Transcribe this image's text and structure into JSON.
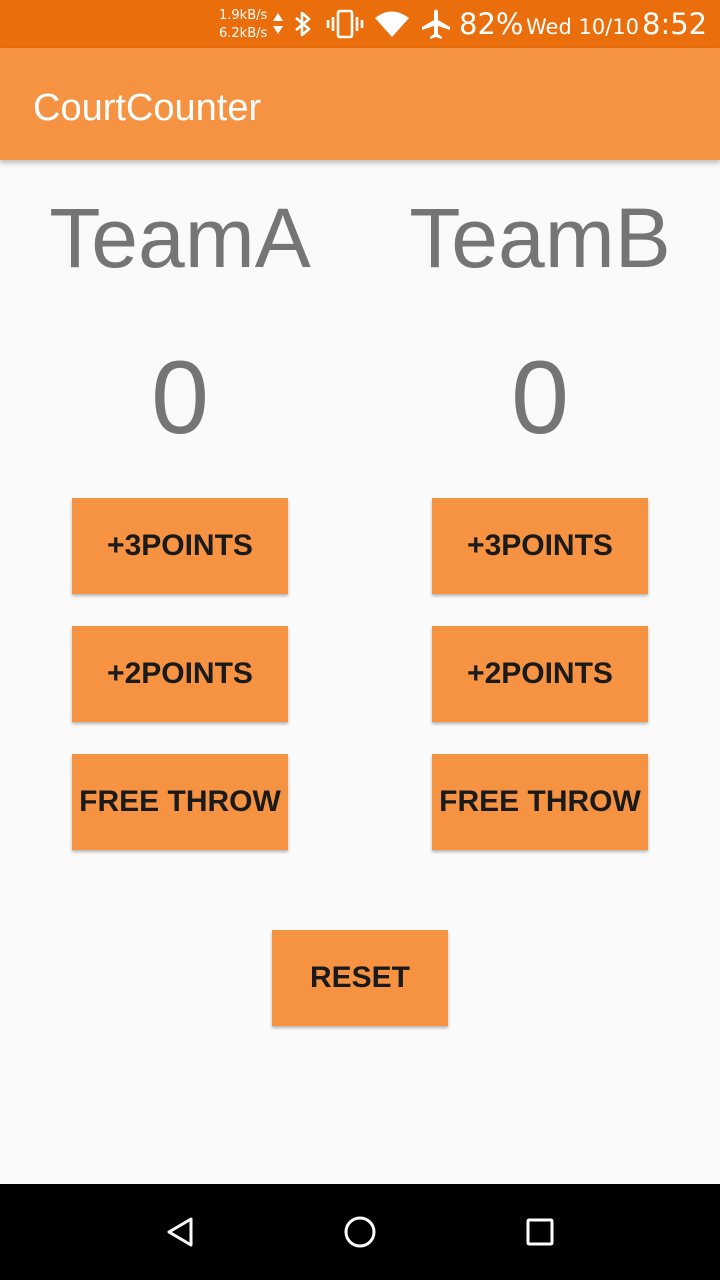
{
  "status_bar": {
    "net_up": "1.9kB/s",
    "net_down": "6.2kB/s",
    "battery": "82%",
    "date": "Wed 10/10",
    "time": "8:52",
    "icons": [
      "data-arrows-icon",
      "bluetooth-icon",
      "vibrate-icon",
      "wifi-icon",
      "airplane-icon"
    ]
  },
  "app_bar": {
    "title": "CourtCounter"
  },
  "teams": [
    {
      "name": "TeamA",
      "score": "0",
      "buttons": {
        "three": "+3POINTS",
        "two": "+2POINTS",
        "free_throw": "FREE THROW"
      }
    },
    {
      "name": "TeamB",
      "score": "0",
      "buttons": {
        "three": "+3POINTS",
        "two": "+2POINTS",
        "free_throw": "FREE THROW"
      }
    }
  ],
  "reset_label": "RESET",
  "nav_bar": {
    "icons": [
      "back-icon",
      "home-icon",
      "recents-icon"
    ]
  },
  "colors": {
    "status_bar": "#ea6e0b",
    "accent": "#f59342",
    "background": "#fafafa",
    "text_gray": "#757575",
    "button_text": "#1a1a1a",
    "nav_bar": "#000000"
  }
}
